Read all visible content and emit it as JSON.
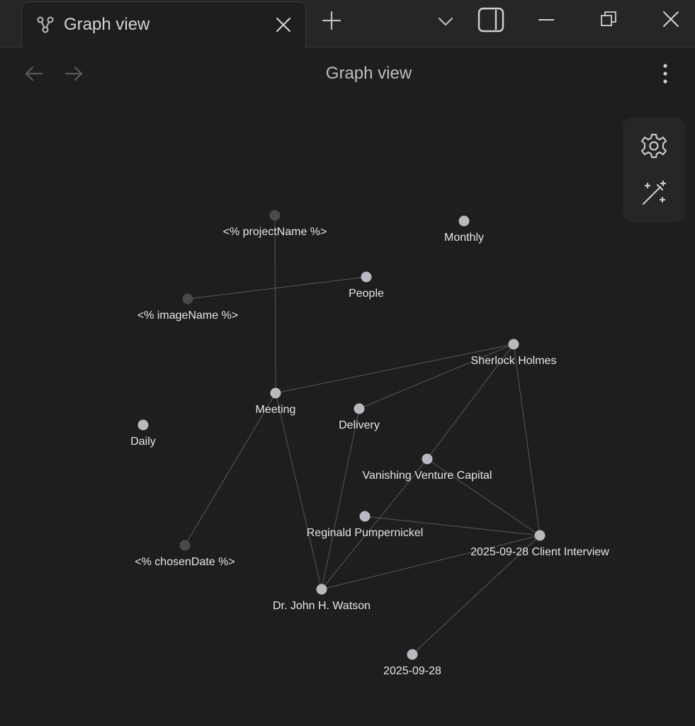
{
  "window": {
    "tab_title": "Graph view",
    "tab_icon": "graph-icon",
    "controls": [
      "new-tab-icon",
      "chevron-down-icon",
      "sidebar-toggle-icon",
      "minimize-icon",
      "restore-icon",
      "close-window-icon"
    ]
  },
  "header": {
    "title": "Graph view",
    "back_icon": "arrow-left-icon",
    "forward_icon": "arrow-right-icon",
    "more_icon": "more-vertical-icon"
  },
  "graph_controls": {
    "settings_icon": "gear-icon",
    "animate_icon": "magic-wand-icon"
  },
  "graph": {
    "nodes": [
      {
        "id": "projectName",
        "label": "<% projectName %>",
        "type": "unresolved"
      },
      {
        "id": "monthly",
        "label": "Monthly",
        "type": "note"
      },
      {
        "id": "people",
        "label": "People",
        "type": "note"
      },
      {
        "id": "imageName",
        "label": "<% imageName %>",
        "type": "unresolved"
      },
      {
        "id": "sherlock",
        "label": "Sherlock Holmes",
        "type": "note"
      },
      {
        "id": "meeting",
        "label": "Meeting",
        "type": "note"
      },
      {
        "id": "delivery",
        "label": "Delivery",
        "type": "note"
      },
      {
        "id": "daily",
        "label": "Daily",
        "type": "note"
      },
      {
        "id": "vvc",
        "label": "Vanishing Venture Capital",
        "type": "note"
      },
      {
        "id": "reginald",
        "label": "Reginald Pumpernickel",
        "type": "note"
      },
      {
        "id": "clientInterview",
        "label": "2025-09-28 Client Interview",
        "type": "note"
      },
      {
        "id": "chosenDate",
        "label": "<% chosenDate %>",
        "type": "unresolved"
      },
      {
        "id": "watson",
        "label": "Dr. John H. Watson",
        "type": "note"
      },
      {
        "id": "date",
        "label": "2025-09-28",
        "type": "note"
      }
    ],
    "edges": [
      [
        "projectName",
        "meeting"
      ],
      [
        "imageName",
        "people"
      ],
      [
        "meeting",
        "sherlock"
      ],
      [
        "delivery",
        "sherlock"
      ],
      [
        "sherlock",
        "vvc"
      ],
      [
        "sherlock",
        "clientInterview"
      ],
      [
        "meeting",
        "chosenDate"
      ],
      [
        "meeting",
        "watson"
      ],
      [
        "delivery",
        "watson"
      ],
      [
        "vvc",
        "watson"
      ],
      [
        "vvc",
        "clientInterview"
      ],
      [
        "reginald",
        "clientInterview"
      ],
      [
        "watson",
        "clientInterview"
      ],
      [
        "clientInterview",
        "date"
      ]
    ],
    "colors": {
      "note": "#b9b9bf",
      "unresolved": "#4a4a4a",
      "edge": "#4f4f4f",
      "label": "#e6e6e6"
    }
  }
}
